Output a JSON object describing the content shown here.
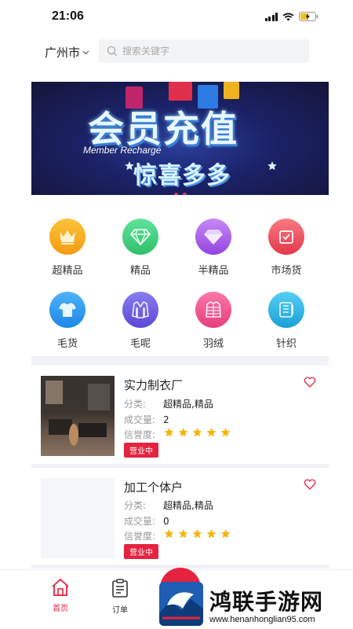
{
  "status_bar": {
    "time": "21:06"
  },
  "header": {
    "city": "广州市",
    "search_placeholder": "搜索关键字"
  },
  "banner": {
    "title": "会员充值",
    "subtitle": "Member Recharge",
    "tagline": "惊喜多多",
    "slide_count": 2,
    "active_slide": 2
  },
  "categories": [
    {
      "label": "超精品",
      "icon": "crown-icon",
      "color": "#f7a21b"
    },
    {
      "label": "精品",
      "icon": "diamond-icon",
      "color": "#3fca7a"
    },
    {
      "label": "半精品",
      "icon": "gem-icon",
      "color": "#a254e8"
    },
    {
      "label": "市场货",
      "icon": "box-icon",
      "color": "#ee4d5d"
    },
    {
      "label": "毛货",
      "icon": "tshirt-icon",
      "color": "#2d9cf0"
    },
    {
      "label": "毛呢",
      "icon": "coat-icon",
      "color": "#6a5ce0"
    },
    {
      "label": "羽绒",
      "icon": "down-jacket-icon",
      "color": "#ef4e8c"
    },
    {
      "label": "针织",
      "icon": "knitwear-icon",
      "color": "#2fb1e3"
    }
  ],
  "shops": [
    {
      "name": "实力制衣厂",
      "category_label": "分类:",
      "category_value": "超精品,精品",
      "volume_label": "成交量:",
      "volume_value": "2",
      "credit_label": "信誉度:",
      "rating": 5,
      "status": "营业中"
    },
    {
      "name": "加工个体户",
      "category_label": "分类:",
      "category_value": "超精品,精品",
      "volume_label": "成交量:",
      "volume_value": "0",
      "credit_label": "信誉度:",
      "rating": 5,
      "status": "营业中"
    }
  ],
  "tabbar": {
    "home": "首页",
    "orders": "订单",
    "accent": "#e5223f"
  },
  "watermark": {
    "title": "鸿联手游网",
    "url": "www.henanhonglian95.com"
  }
}
